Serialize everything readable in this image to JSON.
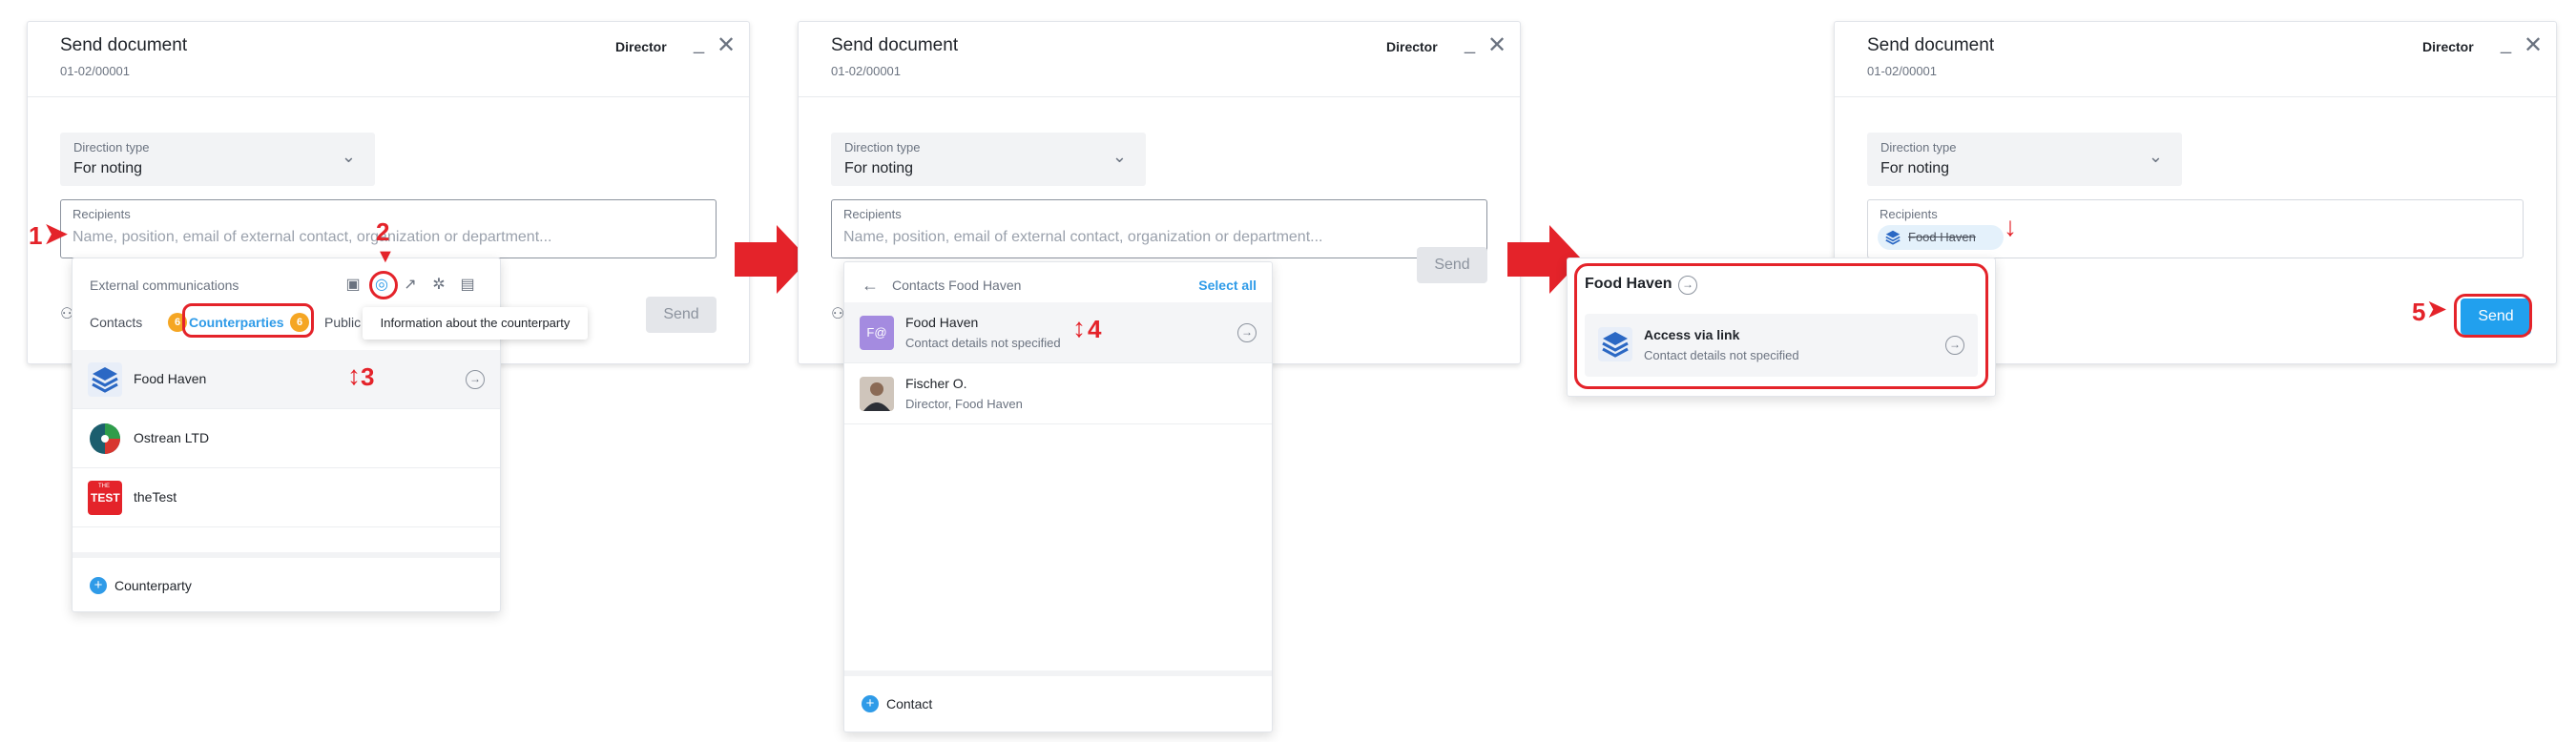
{
  "dialog": {
    "title": "Send document",
    "number": "01-02/00001",
    "role": "Director",
    "minimize": "_",
    "close": "✕",
    "direction_label": "Direction type",
    "direction_value": "For noting",
    "recipients_label": "Recipients",
    "recipients_placeholder": "Name, position, email of external contact, organization or department...",
    "send_label": "Send"
  },
  "panel1": {
    "header": "External communications",
    "tabs": [
      {
        "label": "Contacts",
        "count": "6"
      },
      {
        "label": "Counterparties",
        "count": "6"
      },
      {
        "label": "Public"
      }
    ],
    "tooltip": "Information about the counterparty",
    "items": [
      {
        "name": "Food Haven"
      },
      {
        "name": "Ostrean LTD"
      },
      {
        "name": "theTest",
        "logo_text": "TEST",
        "logo_sup": "THE"
      }
    ],
    "add_label": "Counterparty"
  },
  "panel2": {
    "header": "Contacts Food Haven",
    "select_all": "Select all",
    "items": [
      {
        "name": "Food Haven",
        "sub": "Contact details not specified",
        "avatar": "F@"
      },
      {
        "name": "Fischer O.",
        "sub": "Director, Food Haven"
      }
    ],
    "add_label": "Contact"
  },
  "panel3": {
    "header": "Food Haven",
    "item_name": "Access via link",
    "item_sub": "Contact details not specified",
    "chip_label": "Food Haven"
  },
  "steps": [
    "1",
    "2",
    "3",
    "4",
    "5"
  ],
  "colors": {
    "accent": "#2f9be8",
    "annotation_red": "#e4232a",
    "badge_orange": "#f5a623",
    "send_active": "#21a0ee"
  }
}
